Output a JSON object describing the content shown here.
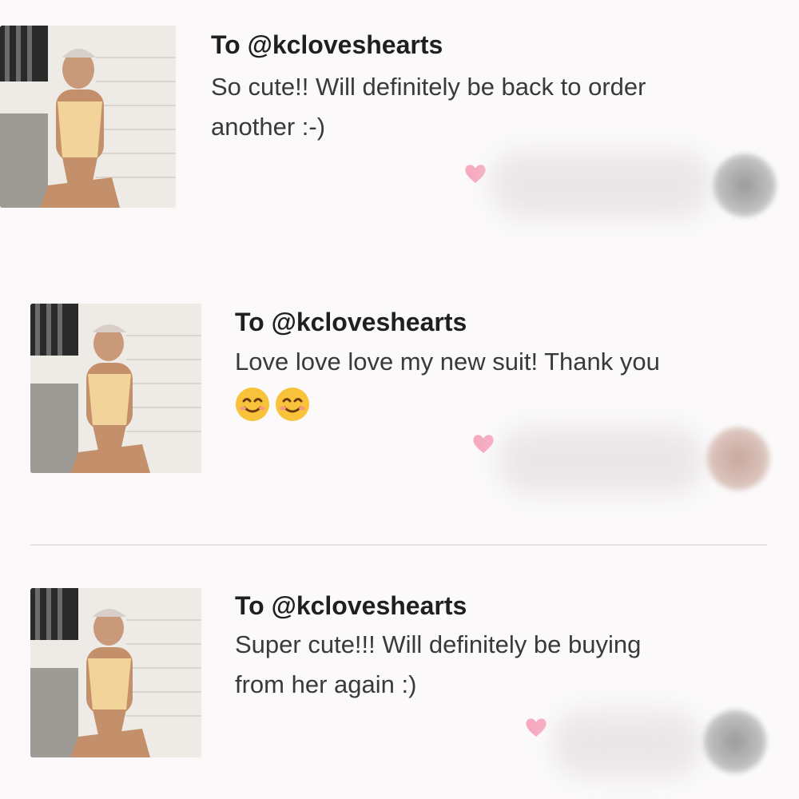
{
  "reviews": [
    {
      "to": "To @kcloveshearts",
      "lines": [
        "So cute!! Will definitely be back to order",
        "another :-)"
      ],
      "emojis": []
    },
    {
      "to": "To @kcloveshearts",
      "lines": [
        "Love love love my new suit! Thank you"
      ],
      "emojis": [
        "smiling-face-with-smiling-eyes",
        "smiling-face-with-smiling-eyes"
      ]
    },
    {
      "to": "To @kcloveshearts",
      "lines": [
        "Super cute!!! Will definitely be buying",
        "from her again :)"
      ],
      "emojis": []
    }
  ],
  "colors": {
    "heart": "#f6a9bf",
    "background": "#fbf9fa",
    "divider": "#e8e2e5"
  }
}
